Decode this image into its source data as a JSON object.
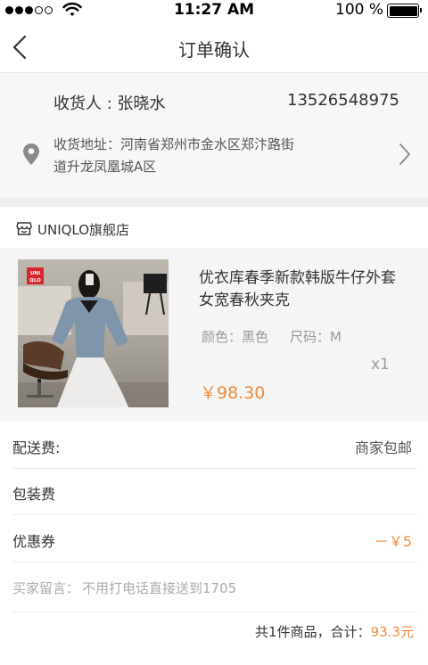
{
  "status_bar": {
    "time": "11:27 AM",
    "battery": "100 %"
  },
  "nav": {
    "title": "订单确认"
  },
  "address": {
    "recipient": "收货人 : 张晓水",
    "phone": "13526548975",
    "line1": "收货地址：河南省郑州市金水区郑汴路街",
    "line2": "道升龙凤凰城A区"
  },
  "store": {
    "name": "UNIQLO旗舰店"
  },
  "product": {
    "title_line1": "优衣库春季新款韩版牛仔外套",
    "title_line2": "女宽春秋夹克",
    "color": "颜色：黑色",
    "size": "尺码：M",
    "quantity": "x1",
    "price": "￥98.30",
    "image_logo_text": "UNI QLO"
  },
  "rows": {
    "shipping_label": "配送费:",
    "shipping_value": "商家包邮",
    "packing_label": "包装费",
    "coupon_label": "优惠券",
    "coupon_value": "－￥5",
    "message_label": "买家留言：",
    "message_value": "不用打电话直接送到1705"
  },
  "summary": {
    "text": "共1件商品，合计：",
    "total": "93.3元"
  },
  "colors": {
    "accent": "#f08a3a",
    "brand_red": "#d7282f"
  }
}
